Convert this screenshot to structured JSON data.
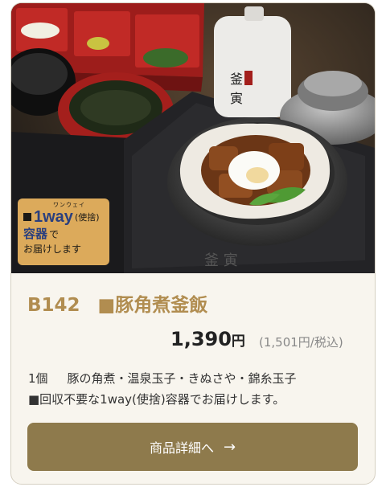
{
  "product": {
    "code": "B142",
    "name": "■豚角煮釜飯",
    "price_value": "1,390",
    "price_unit": "円",
    "tax_included": "(1,501円/税込)",
    "quantity": "1個",
    "contents": "豚の角煮・温泉玉子・きぬさや・錦糸玉子",
    "note": "■回収不要な1way(使捨)容器でお届けします。"
  },
  "badge": {
    "ruby": "ワンウェイ",
    "big": "1way",
    "small": "(使捨)",
    "strong": "容器",
    "de": "で",
    "line3": "お届けします",
    "logo_text": "釜寅"
  },
  "button": {
    "label": "商品詳細へ",
    "arrow": "→"
  },
  "colors": {
    "accent": "#b18d50",
    "button": "#8e7a4c",
    "badge": "#dcaa5b",
    "card_bg": "#f8f5ee"
  }
}
